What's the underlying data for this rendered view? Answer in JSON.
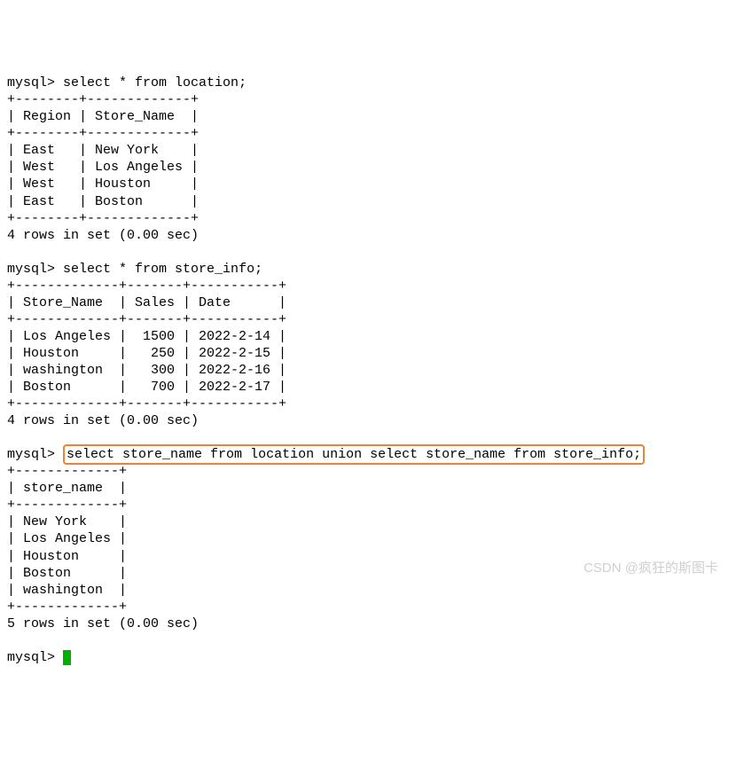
{
  "prompt": "mysql>",
  "queries": {
    "q1": "select * from location;",
    "q2": "select * from store_info;",
    "q3": "select store_name from location union select store_name from store_info;"
  },
  "table1": {
    "sep_top": "+--------+-------------+",
    "header": "| Region | Store_Name  |",
    "sep_mid": "+--------+-------------+",
    "rows": {
      "r1": "| East   | New York    |",
      "r2": "| West   | Los Angeles |",
      "r3": "| West   | Houston     |",
      "r4": "| East   | Boston      |"
    },
    "sep_bot": "+--------+-------------+",
    "footer": "4 rows in set (0.00 sec)"
  },
  "table2": {
    "sep_top": "+-------------+-------+-----------+",
    "header": "| Store_Name  | Sales | Date      |",
    "sep_mid": "+-------------+-------+-----------+",
    "rows": {
      "r1": "| Los Angeles |  1500 | 2022-2-14 |",
      "r2": "| Houston     |   250 | 2022-2-15 |",
      "r3": "| washington  |   300 | 2022-2-16 |",
      "r4": "| Boston      |   700 | 2022-2-17 |"
    },
    "sep_bot": "+-------------+-------+-----------+",
    "footer": "4 rows in set (0.00 sec)"
  },
  "table3": {
    "sep_top": "+-------------+",
    "header": "| store_name  |",
    "sep_mid": "+-------------+",
    "rows": {
      "r1": "| New York    |",
      "r2": "| Los Angeles |",
      "r3": "| Houston     |",
      "r4": "| Boston      |",
      "r5": "| washington  |"
    },
    "sep_bot": "+-------------+",
    "footer": "5 rows in set (0.00 sec)"
  },
  "watermark": "CSDN @疯狂的斯图卡"
}
